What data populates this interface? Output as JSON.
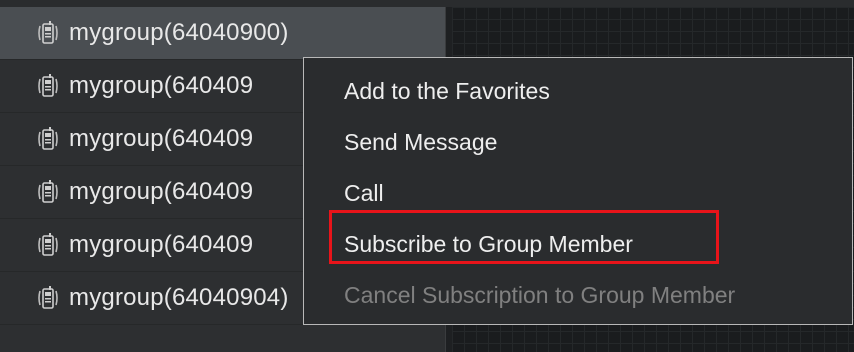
{
  "groups": [
    {
      "label": "mygroup(64040900)",
      "selected": true
    },
    {
      "label": "mygroup(640409",
      "selected": false
    },
    {
      "label": "mygroup(640409",
      "selected": false
    },
    {
      "label": "mygroup(640409",
      "selected": false
    },
    {
      "label": "mygroup(640409",
      "selected": false
    },
    {
      "label": "mygroup(64040904)",
      "selected": false
    }
  ],
  "context_menu": {
    "items": [
      {
        "label": "Add to the Favorites",
        "enabled": true
      },
      {
        "label": "Send Message",
        "enabled": true
      },
      {
        "label": "Call",
        "enabled": true
      },
      {
        "label": "Subscribe to Group Member",
        "enabled": true,
        "highlighted": true
      },
      {
        "label": "Cancel Subscription to Group Member",
        "enabled": false
      }
    ]
  },
  "icons": {
    "group_icon": "radio-group-icon"
  },
  "colors": {
    "highlight_border": "#e8141a",
    "selected_row": "#4a4e52",
    "menu_background": "#2a2c2e",
    "disabled_text": "#808080"
  }
}
